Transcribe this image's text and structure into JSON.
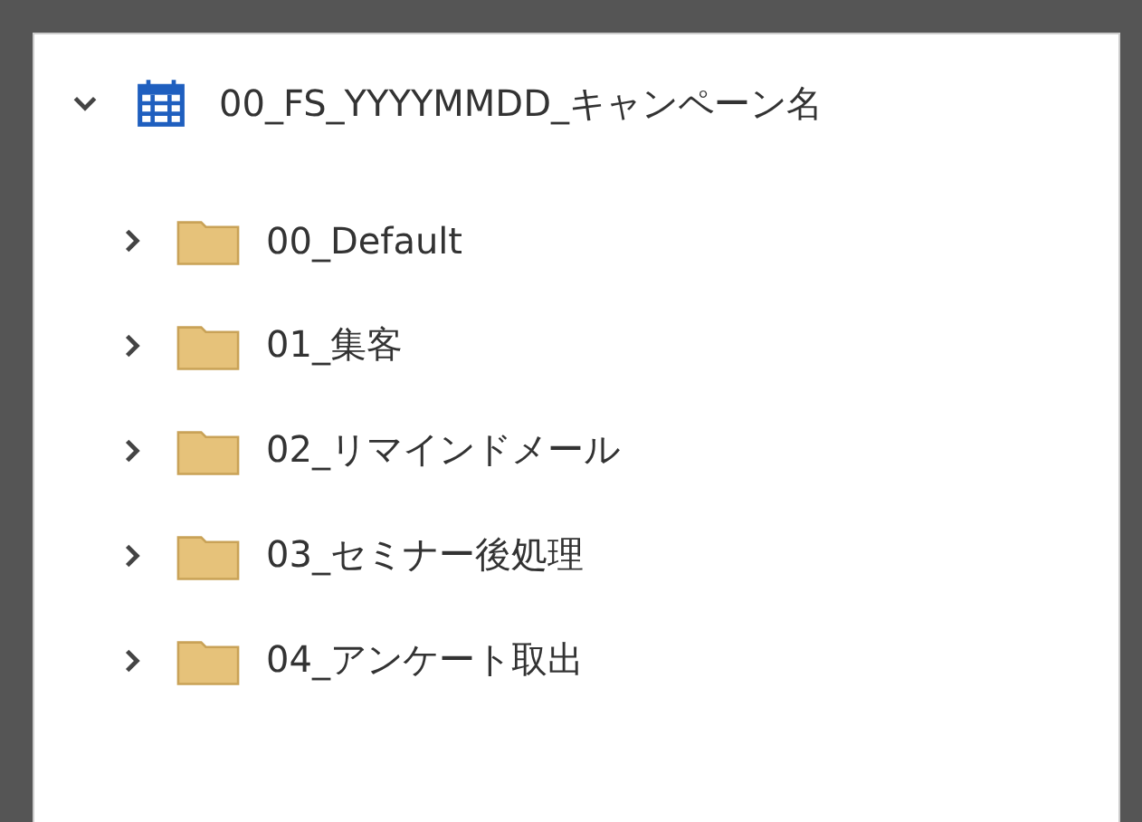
{
  "tree": [
    {
      "label": "00_FS_YYYYMMDD_キャンペーン名",
      "kind": "calendar",
      "expanded": true,
      "children": [
        {
          "label": "00_Default",
          "kind": "folder",
          "expanded": false
        },
        {
          "label": "01_集客",
          "kind": "folder",
          "expanded": false
        },
        {
          "label": "02_リマインドメール",
          "kind": "folder",
          "expanded": false
        },
        {
          "label": "03_セミナー後処理",
          "kind": "folder",
          "expanded": false
        },
        {
          "label": "04_アンケート取出",
          "kind": "folder",
          "expanded": false
        }
      ]
    }
  ]
}
